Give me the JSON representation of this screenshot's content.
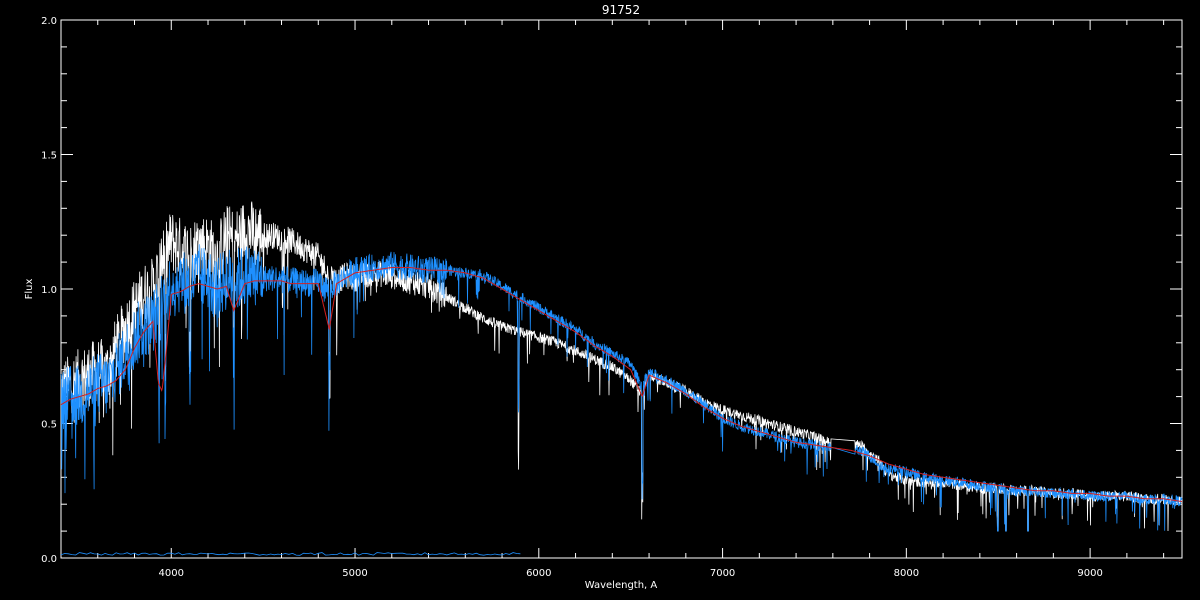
{
  "chart_data": {
    "type": "line",
    "title": "91752",
    "xlabel": "Wavelength, A",
    "ylabel": "Flux",
    "xlim": [
      3400,
      9500
    ],
    "ylim": [
      0.0,
      2.0
    ],
    "xticks": [
      4000,
      5000,
      6000,
      7000,
      8000,
      9000
    ],
    "xtick_labels": [
      "4000",
      "5000",
      "6000",
      "7000",
      "8000",
      "9000"
    ],
    "yticks": [
      0.0,
      0.5,
      1.0,
      1.5,
      2.0
    ],
    "ytick_labels": [
      "0.0",
      "0.5",
      "1.0",
      "1.5",
      "2.0"
    ],
    "background": "#000000",
    "axis_color": "#ffffff",
    "grid": false,
    "series": [
      {
        "color": "#ffffff",
        "style": "noisy",
        "x": [
          3400,
          3450,
          3500,
          3550,
          3600,
          3650,
          3700,
          3750,
          3800,
          3850,
          3900,
          3950,
          4000,
          4050,
          4100,
          4150,
          4200,
          4250,
          4300,
          4350,
          4400,
          4450,
          4500,
          4550,
          4600,
          4650,
          4700,
          4750,
          4800,
          4850,
          4900,
          4950,
          5000,
          5100,
          5200,
          5300,
          5400,
          5500,
          5600,
          5700,
          5800,
          5900,
          6000,
          6100,
          6200,
          6300,
          6400,
          6500,
          6560,
          6600,
          6700,
          6800,
          6900,
          7000,
          7100,
          7200,
          7300,
          7400,
          7500,
          7580,
          7750,
          7800,
          7850,
          7900,
          7950,
          8000,
          8100,
          8200,
          8300,
          8400,
          8500,
          8600,
          8700,
          8800,
          8900,
          9000,
          9100,
          9200,
          9300,
          9400,
          9500
        ],
        "y": [
          0.62,
          0.64,
          0.66,
          0.68,
          0.7,
          0.69,
          0.78,
          0.85,
          0.92,
          0.98,
          1.0,
          1.1,
          1.18,
          1.15,
          1.13,
          1.17,
          1.16,
          1.12,
          1.2,
          1.18,
          1.22,
          1.21,
          1.2,
          1.2,
          1.19,
          1.18,
          1.16,
          1.14,
          1.12,
          1.06,
          1.03,
          1.05,
          1.04,
          1.06,
          1.05,
          1.03,
          1.01,
          0.97,
          0.93,
          0.89,
          0.86,
          0.84,
          0.82,
          0.8,
          0.77,
          0.74,
          0.71,
          0.66,
          0.61,
          0.68,
          0.65,
          0.62,
          0.58,
          0.55,
          0.53,
          0.51,
          0.49,
          0.47,
          0.45,
          0.43,
          0.42,
          0.39,
          0.36,
          0.31,
          0.3,
          0.29,
          0.28,
          0.28,
          0.27,
          0.26,
          0.26,
          0.25,
          0.25,
          0.24,
          0.24,
          0.23,
          0.23,
          0.23,
          0.22,
          0.22,
          0.21
        ]
      },
      {
        "color": "#1e90ff",
        "style": "noisy",
        "x": [
          3400,
          3450,
          3500,
          3550,
          3600,
          3650,
          3700,
          3750,
          3800,
          3850,
          3900,
          3950,
          4000,
          4050,
          4100,
          4150,
          4200,
          4250,
          4300,
          4350,
          4400,
          4450,
          4500,
          4550,
          4600,
          4650,
          4700,
          4750,
          4800,
          4850,
          4900,
          4950,
          5000,
          5100,
          5200,
          5300,
          5400,
          5500,
          5600,
          5700,
          5800,
          5900,
          6000,
          6100,
          6200,
          6300,
          6400,
          6500,
          6560,
          6600,
          6700,
          6800,
          6900,
          7000,
          7100,
          7200,
          7300,
          7400,
          7500,
          7580,
          7750,
          7800,
          7850,
          7900,
          7950,
          8000,
          8100,
          8200,
          8300,
          8400,
          8500,
          8600,
          8700,
          8800,
          8900,
          9000,
          9100,
          9200,
          9300,
          9400,
          9500
        ],
        "y": [
          0.58,
          0.6,
          0.6,
          0.62,
          0.65,
          0.64,
          0.7,
          0.76,
          0.82,
          0.86,
          0.88,
          0.95,
          1.02,
          1.03,
          1.02,
          1.05,
          1.04,
          1.0,
          1.04,
          1.03,
          1.05,
          1.05,
          1.04,
          1.04,
          1.04,
          1.03,
          1.03,
          1.02,
          1.03,
          1.0,
          1.02,
          1.05,
          1.07,
          1.08,
          1.09,
          1.08,
          1.07,
          1.07,
          1.06,
          1.05,
          1.01,
          0.97,
          0.93,
          0.89,
          0.85,
          0.8,
          0.76,
          0.72,
          0.64,
          0.69,
          0.66,
          0.62,
          0.57,
          0.52,
          0.49,
          0.47,
          0.45,
          0.43,
          0.42,
          0.41,
          0.4,
          0.38,
          0.35,
          0.33,
          0.33,
          0.32,
          0.3,
          0.29,
          0.28,
          0.27,
          0.26,
          0.25,
          0.25,
          0.24,
          0.24,
          0.23,
          0.23,
          0.23,
          0.22,
          0.22,
          0.21
        ]
      },
      {
        "color": "#d42020",
        "style": "smooth",
        "x": [
          3400,
          3450,
          3500,
          3550,
          3600,
          3650,
          3700,
          3750,
          3800,
          3850,
          3900,
          3930,
          3950,
          3970,
          4000,
          4050,
          4100,
          4150,
          4200,
          4250,
          4300,
          4340,
          4400,
          4450,
          4500,
          4550,
          4600,
          4650,
          4700,
          4750,
          4800,
          4860,
          4900,
          4950,
          5000,
          5100,
          5200,
          5300,
          5400,
          5500,
          5600,
          5700,
          5800,
          5900,
          6000,
          6100,
          6200,
          6300,
          6400,
          6500,
          6563,
          6600,
          6700,
          6800,
          6900,
          7000,
          7100,
          7200,
          7300,
          7400,
          7500,
          7600,
          7700,
          7800,
          7900,
          8000,
          8100,
          8200,
          8300,
          8400,
          8500,
          8600,
          8700,
          8800,
          8900,
          9000,
          9100,
          9200,
          9300,
          9400,
          9500
        ],
        "y": [
          0.57,
          0.59,
          0.6,
          0.61,
          0.63,
          0.64,
          0.66,
          0.7,
          0.78,
          0.84,
          0.88,
          0.65,
          0.62,
          0.75,
          0.98,
          0.99,
          1.01,
          1.02,
          1.01,
          1.0,
          1.01,
          0.92,
          1.02,
          1.03,
          1.03,
          1.03,
          1.03,
          1.02,
          1.02,
          1.02,
          1.02,
          0.85,
          1.02,
          1.04,
          1.06,
          1.07,
          1.08,
          1.08,
          1.07,
          1.07,
          1.06,
          1.04,
          1.0,
          0.96,
          0.92,
          0.88,
          0.84,
          0.79,
          0.75,
          0.7,
          0.6,
          0.68,
          0.65,
          0.61,
          0.56,
          0.52,
          0.49,
          0.47,
          0.45,
          0.43,
          0.42,
          0.41,
          0.4,
          0.38,
          0.35,
          0.33,
          0.31,
          0.3,
          0.29,
          0.28,
          0.27,
          0.26,
          0.25,
          0.25,
          0.24,
          0.24,
          0.23,
          0.23,
          0.22,
          0.22,
          0.21
        ]
      }
    ],
    "absorption_lines": [
      3934,
      3968,
      4101,
      4340,
      4861,
      5890,
      6563,
      7600,
      8498,
      8542,
      8662
    ]
  }
}
